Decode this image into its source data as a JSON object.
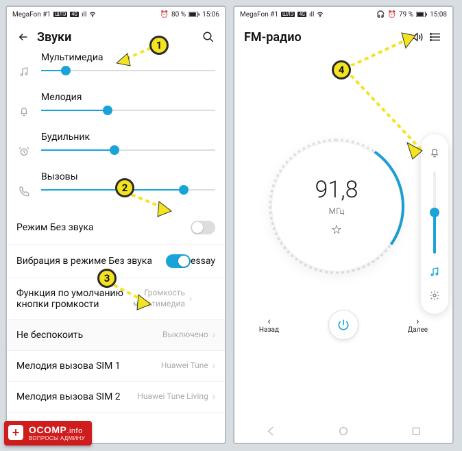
{
  "left": {
    "status": {
      "carrier": "MegaFon #1",
      "badge1": "ШЛЭ",
      "badge2": "4G",
      "signal": "ıll",
      "alarm": "⏰",
      "battery_pct": "80 %",
      "time": "15:06"
    },
    "header": {
      "title": "Звуки"
    },
    "sliders": [
      {
        "label": "Мультимедиа",
        "pct": 14
      },
      {
        "label": "Мелодия",
        "pct": 38
      },
      {
        "label": "Будильник",
        "pct": 42
      },
      {
        "label": "Вызовы",
        "pct": 82
      }
    ],
    "rows": {
      "silent": {
        "label": "Режим Без звука",
        "on": false
      },
      "vibrate": {
        "label": "Вибрация в режиме Без звука",
        "on": true
      },
      "volbtn": {
        "label": "Функция по умолчанию кнопки громкости",
        "value_l1": "Громкость",
        "value_l2": "мультимедиа"
      },
      "dnd": {
        "label": "Не беспокоить",
        "value": "Выключено"
      },
      "sim1": {
        "label": "Мелодия вызова SIM 1",
        "value": "Huawei Tune"
      },
      "sim2": {
        "label": "Мелодия вызова SIM 2",
        "value": "Huawei Tune Living"
      }
    }
  },
  "right": {
    "status": {
      "carrier": "MegaFon #1",
      "badge1": "ШЛЭ",
      "badge2": "4G",
      "signal": "ıll",
      "headphones": "🎧",
      "alarm": "⏰",
      "battery_pct": "79 %",
      "time": "15:08"
    },
    "header": {
      "title": "FM-радио"
    },
    "dial": {
      "freq": "91,8",
      "unit": "МГц"
    },
    "volpanel": {
      "pct": 50
    },
    "bottom": {
      "back": "Назад",
      "next": "Далее"
    }
  },
  "badge": {
    "brand": "OCOMP",
    "tld": ".info",
    "tagline": "ВОПРОСЫ АДМИНУ"
  },
  "markers": {
    "m1": "1",
    "m2": "2",
    "m3": "3",
    "m4": "4"
  }
}
